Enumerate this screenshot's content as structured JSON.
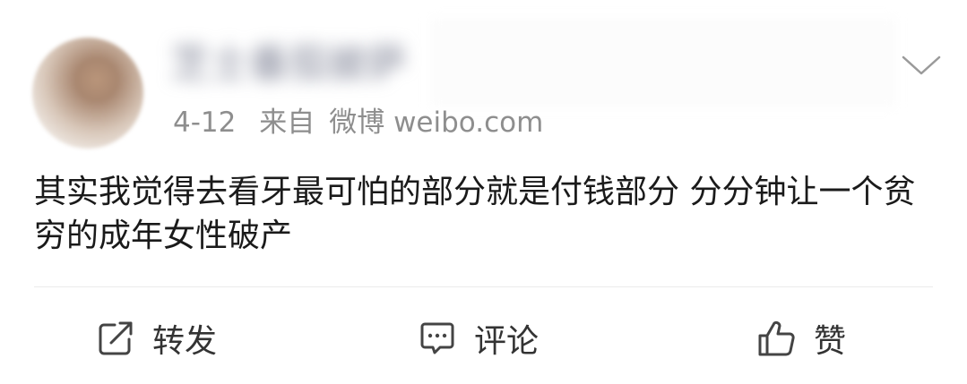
{
  "post": {
    "author": "芝士番茄披萨",
    "date": "4-12",
    "source_prefix": "来自",
    "source": "微博 weibo.com",
    "text": "其实我觉得去看牙最可怕的部分就是付钱部分 分分钟让一个贫穷的成年女性破产"
  },
  "actions": {
    "repost_label": "转发",
    "comment_label": "评论",
    "like_label": "赞"
  },
  "icons": {
    "repost": "share-icon",
    "comment": "comment-icon",
    "like": "thumbs-up-icon",
    "menu": "chevron-down-icon"
  },
  "colors": {
    "text": "#1a1a1a",
    "meta": "#8e8e8e",
    "icon": "#444444"
  }
}
